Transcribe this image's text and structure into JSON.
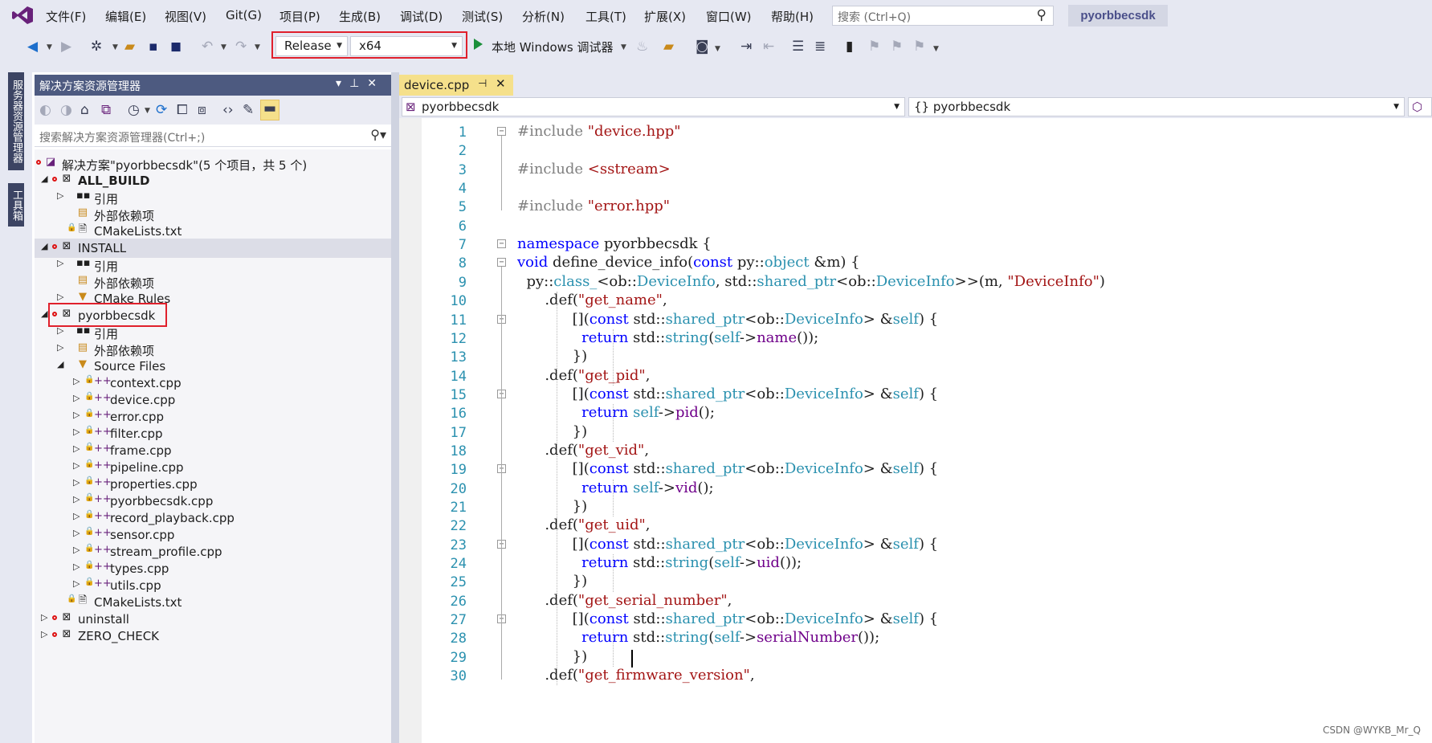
{
  "menubar": {
    "items": [
      "文件(F)",
      "编辑(E)",
      "视图(V)",
      "Git(G)",
      "项目(P)",
      "生成(B)",
      "调试(D)",
      "测试(S)",
      "分析(N)",
      "工具(T)",
      "扩展(X)",
      "窗口(W)",
      "帮助(H)"
    ],
    "search_placeholder": "搜索 (Ctrl+Q)",
    "solution_name": "pyorbbecsdk"
  },
  "toolbar": {
    "configuration": "Release",
    "platform": "x64",
    "debugger": "本地 Windows 调试器"
  },
  "left_strip": {
    "server_explorer": "服务器资源管理器",
    "toolbox": "工具箱"
  },
  "solution_explorer": {
    "title": "解决方案资源管理器",
    "search_placeholder": "搜索解决方案资源管理器(Ctrl+;)",
    "tree": [
      {
        "label": "解决方案\"pyorbbecsdk\"(5 个项目，共 5 个)"
      },
      {
        "label": "ALL_BUILD"
      },
      {
        "label": "引用"
      },
      {
        "label": "外部依赖项"
      },
      {
        "label": "CMakeLists.txt"
      },
      {
        "label": "INSTALL"
      },
      {
        "label": "引用"
      },
      {
        "label": "外部依赖项"
      },
      {
        "label": "CMake Rules"
      },
      {
        "label": "pyorbbecsdk"
      },
      {
        "label": "引用"
      },
      {
        "label": "外部依赖项"
      },
      {
        "label": "Source Files"
      },
      {
        "label": "context.cpp"
      },
      {
        "label": "device.cpp"
      },
      {
        "label": "error.cpp"
      },
      {
        "label": "filter.cpp"
      },
      {
        "label": "frame.cpp"
      },
      {
        "label": "pipeline.cpp"
      },
      {
        "label": "properties.cpp"
      },
      {
        "label": "pyorbbecsdk.cpp"
      },
      {
        "label": "record_playback.cpp"
      },
      {
        "label": "sensor.cpp"
      },
      {
        "label": "stream_profile.cpp"
      },
      {
        "label": "types.cpp"
      },
      {
        "label": "utils.cpp"
      },
      {
        "label": "CMakeLists.txt"
      },
      {
        "label": "uninstall"
      },
      {
        "label": "ZERO_CHECK"
      }
    ]
  },
  "editor": {
    "tab": "device.cpp",
    "nav_project": "pyorbbecsdk",
    "nav_scope": "{} pyorbbecsdk",
    "line_numbers": [
      "1",
      "2",
      "3",
      "4",
      "5",
      "6",
      "7",
      "8",
      "9",
      "10",
      "11",
      "12",
      "13",
      "14",
      "15",
      "16",
      "17",
      "18",
      "19",
      "20",
      "21",
      "22",
      "23",
      "24",
      "25",
      "26",
      "27",
      "28",
      "29",
      "30"
    ],
    "lines": [
      "#include \"device.hpp\"",
      "",
      "#include <sstream>",
      "",
      "#include \"error.hpp\"",
      "",
      "namespace pyorbbecsdk {",
      "void define_device_info(const py::object &m) {",
      "  py::class_<ob::DeviceInfo, std::shared_ptr<ob::DeviceInfo>>(m, \"DeviceInfo\")",
      "      .def(\"get_name\",",
      "            [](const std::shared_ptr<ob::DeviceInfo> &self) {",
      "              return std::string(self->name());",
      "            })",
      "      .def(\"get_pid\",",
      "            [](const std::shared_ptr<ob::DeviceInfo> &self) {",
      "              return self->pid();",
      "            })",
      "      .def(\"get_vid\",",
      "            [](const std::shared_ptr<ob::DeviceInfo> &self) {",
      "              return self->vid();",
      "            })",
      "      .def(\"get_uid\",",
      "            [](const std::shared_ptr<ob::DeviceInfo> &self) {",
      "              return std::string(self->uid());",
      "            })",
      "      .def(\"get_serial_number\",",
      "            [](const std::shared_ptr<ob::DeviceInfo> &self) {",
      "              return std::string(self->serialNumber());",
      "            })",
      "      .def(\"get_firmware_version\","
    ]
  },
  "watermark": "CSDN @WYKB_Mr_Q",
  "colors": {
    "highlight_box": "#e0202c",
    "tab_active": "#f5e08b",
    "header": "#4d5a80",
    "keyword": "#0000ff",
    "string": "#a31515",
    "type": "#2b91af"
  }
}
